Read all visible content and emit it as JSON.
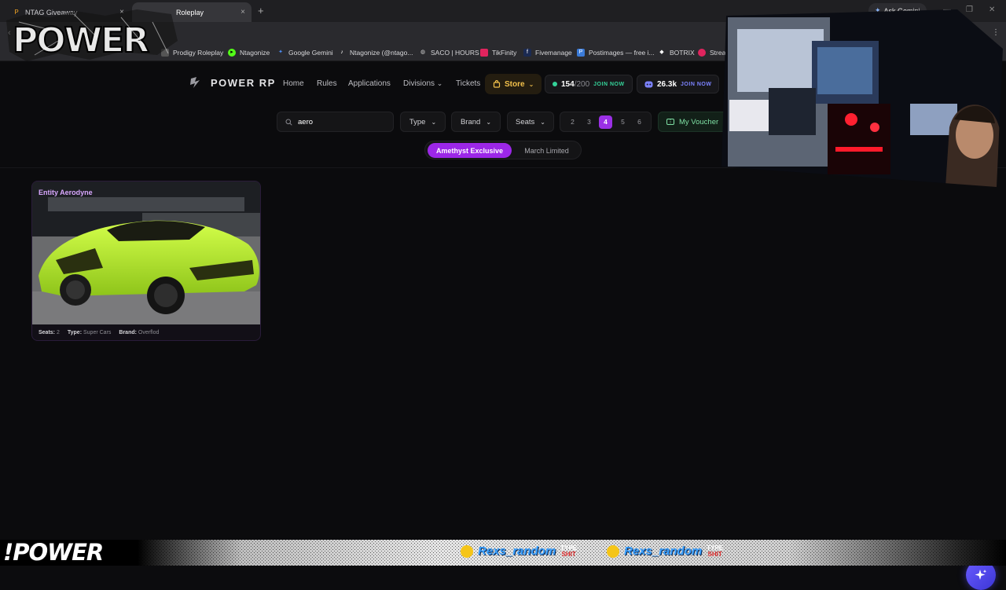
{
  "browser": {
    "tabs": [
      {
        "title": "NTAG Giveaway",
        "close": "×"
      },
      {
        "title": "Roleplay",
        "close": "×"
      }
    ],
    "new_tab": "+",
    "ask_gemini": "Ask Gemini",
    "window_controls": [
      "—",
      "❐",
      "✕"
    ],
    "bookmarks": [
      {
        "label": "Prodigy Roleplay",
        "icon": "prodigy-icon",
        "color": "#888888"
      },
      {
        "label": "Ntagonize",
        "icon": "play-icon",
        "color": "#53fc18"
      },
      {
        "label": "Google Gemini",
        "icon": "gemini-icon",
        "color": "#4c8df6"
      },
      {
        "label": "Ntagonize (@ntago...",
        "icon": "tiktok-icon",
        "color": "#000000"
      },
      {
        "label": "SACO | HOURS",
        "icon": "globe-icon",
        "color": "#666666"
      },
      {
        "label": "TikFinity",
        "icon": "tikfinity-icon",
        "color": "#e0245e"
      },
      {
        "label": "Fivemanage",
        "icon": "fivemanage-icon",
        "color": "#222222"
      },
      {
        "label": "Postimages — free i...",
        "icon": "postimages-icon",
        "color": "#3b7bd8"
      },
      {
        "label": "BOTRIX",
        "icon": "botrix-icon",
        "color": "#ffffff"
      },
      {
        "label": "Strea",
        "icon": "stream-icon",
        "color": "#e0245e"
      }
    ]
  },
  "site": {
    "brand": "POWER RP",
    "nav": [
      "Home",
      "Rules",
      "Applications",
      "Divisions",
      "Tickets"
    ],
    "divisions_caret": "⌄",
    "store_label": "Store",
    "players": {
      "online": "154",
      "max": "/200",
      "cta": "JOIN NOW"
    },
    "discord": {
      "count": "26.3k",
      "cta": "JOIN NOW"
    }
  },
  "filters": {
    "search_value": "aero",
    "type_label": "Type",
    "brand_label": "Brand",
    "seats_label": "Seats",
    "pages": [
      "2",
      "3",
      "4",
      "5",
      "6"
    ],
    "active_page": "4",
    "voucher_label": "My Voucher",
    "segments": [
      "Amethyst Exclusive",
      "March Limited"
    ],
    "active_segment": "Amethyst Exclusive"
  },
  "vehicles": [
    {
      "name": "Entity Aerodyne",
      "seats_label": "Seats:",
      "seats": "2",
      "type_label": "Type:",
      "type": "Super Cars",
      "brand_label": "Brand:",
      "brand": "Overflod"
    }
  ],
  "overlay": {
    "ticker_brand": "!POWER",
    "ticker_user": "Rexs_random",
    "badge_top": "TYPE",
    "badge_bottom": "SHIT"
  },
  "colors": {
    "accent_purple": "#9c27e8",
    "store_gold": "#f3c14b",
    "online_green": "#34d399",
    "discord_blue": "#7c83ff",
    "car_lime": "#b5f22a"
  }
}
